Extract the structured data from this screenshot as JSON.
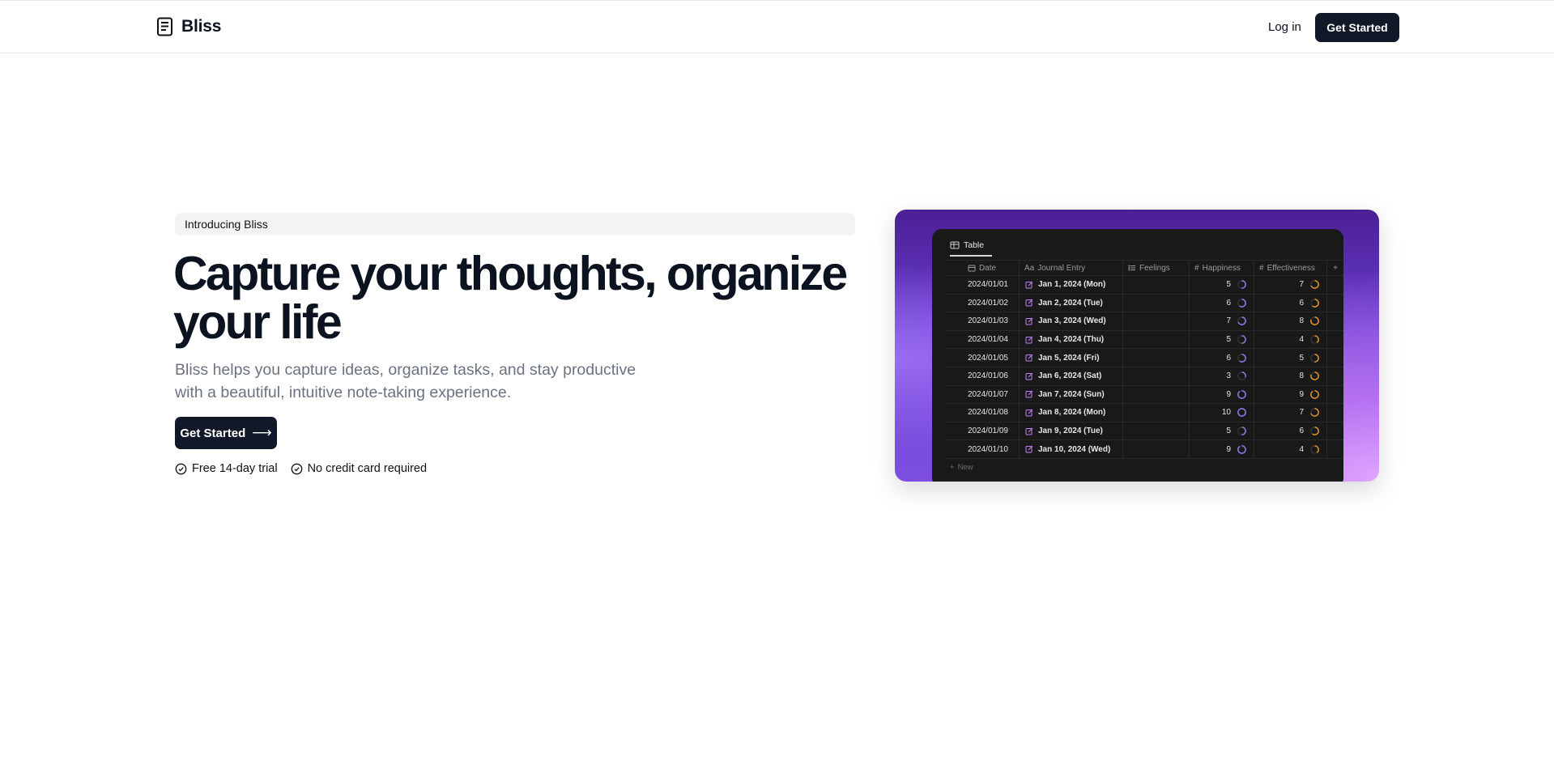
{
  "header": {
    "brand": "Bliss",
    "login_label": "Log in",
    "cta_label": "Get Started"
  },
  "hero": {
    "pill": "Introducing Bliss",
    "headline_line1": "Capture your thoughts, organize",
    "headline_line2": "your life",
    "subtext_line1": "Bliss helps you capture ideas, organize tasks, and stay productive",
    "subtext_line2": "with a beautiful, intuitive note-taking experience.",
    "cta_label": "Get Started",
    "cta_arrow": "⟶",
    "checks": [
      "Free 14-day trial",
      "No credit card required"
    ]
  },
  "preview": {
    "tab_label": "Table",
    "columns": {
      "date": "Date",
      "entry": "Journal Entry",
      "entry_prefix": "Aa",
      "feelings": "Feelings",
      "happiness": "Happiness",
      "effectiveness": "Effectiveness",
      "add": "+"
    },
    "rows": [
      {
        "date": "2024/01/01",
        "entry": "Jan 1, 2024 (Mon)",
        "happiness": "5",
        "effectiveness": "7"
      },
      {
        "date": "2024/01/02",
        "entry": "Jan 2, 2024 (Tue)",
        "happiness": "6",
        "effectiveness": "6"
      },
      {
        "date": "2024/01/03",
        "entry": "Jan 3, 2024 (Wed)",
        "happiness": "7",
        "effectiveness": "8"
      },
      {
        "date": "2024/01/04",
        "entry": "Jan 4, 2024 (Thu)",
        "happiness": "5",
        "effectiveness": "4"
      },
      {
        "date": "2024/01/05",
        "entry": "Jan 5, 2024 (Fri)",
        "happiness": "6",
        "effectiveness": "5"
      },
      {
        "date": "2024/01/06",
        "entry": "Jan 6, 2024 (Sat)",
        "happiness": "3",
        "effectiveness": "8"
      },
      {
        "date": "2024/01/07",
        "entry": "Jan 7, 2024 (Sun)",
        "happiness": "9",
        "effectiveness": "9"
      },
      {
        "date": "2024/01/08",
        "entry": "Jan 8, 2024 (Mon)",
        "happiness": "10",
        "effectiveness": "7"
      },
      {
        "date": "2024/01/09",
        "entry": "Jan 9, 2024 (Tue)",
        "happiness": "5",
        "effectiveness": "6"
      },
      {
        "date": "2024/01/10",
        "entry": "Jan 10, 2024 (Wed)",
        "happiness": "9",
        "effectiveness": "4"
      }
    ],
    "new_label": "New",
    "new_prefix": "+",
    "colors": {
      "happiness_ring": "#8b7cf6",
      "effectiveness_ring": "#e0952b"
    }
  }
}
